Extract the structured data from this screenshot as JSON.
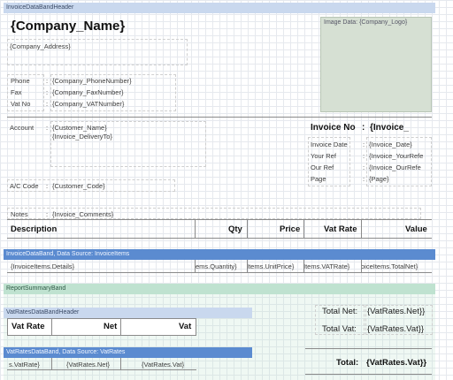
{
  "bands": {
    "invoice_header": "InvoiceDataBandHeader",
    "invoice_band": "InvoiceDataBand, Data Source: InvoiceItems",
    "report_summary": "ReportSummaryBand",
    "vat_header": "VatRatesDataBandHeader",
    "vat_band": "VatRatesDataBand, Data Source: VatRates"
  },
  "company": {
    "name": "{Company_Name}",
    "address": "{Company_Address}",
    "logo": "Image Data: {Company_Logo}"
  },
  "contact": {
    "phone_label": "Phone",
    "fax_label": "Fax",
    "vat_label": "Vat No",
    "phone_value": "{Company_PhoneNumber}",
    "fax_value": "{Company_FaxNumber}",
    "vat_value": "{Company_VATNumber}"
  },
  "account": {
    "label": "Account",
    "customer_name": "{Customer_Name}",
    "delivery_to": "{Invoice_DeliveryTo}",
    "ac_code_label": "A/C Code",
    "customer_code": "{Customer_Code}",
    "notes_label": "Notes",
    "comments": "{Invoice_Comments}"
  },
  "invoice": {
    "no_label": "Invoice No",
    "no_sep": ":",
    "no_value": "{Invoice_",
    "date_label": "Invoice Date",
    "your_ref_label": "Your Ref",
    "our_ref_label": "Our Ref",
    "page_label": "Page",
    "date_value": "{Invoice_Date}",
    "your_ref_value": "{Invoice_YourRefe",
    "our_ref_value": "{Invoice_OurRefe",
    "page_value": "{Page}"
  },
  "table": {
    "headers": [
      "Description",
      "Qty",
      "Price",
      "Vat Rate",
      "Value"
    ],
    "row": [
      "{InvoiceItems.Details}",
      "ems.Quantity}",
      "Items.UnitPrice}",
      "Items.VATRate}",
      "oiceItems.TotalNet}"
    ]
  },
  "vat_table": {
    "headers": [
      "Vat Rate",
      "Net",
      "Vat"
    ],
    "row": [
      "s.VatRate}",
      "{VatRates.Net}",
      "{VatRates.Vat}"
    ]
  },
  "totals": {
    "total_net_label": "Total Net:",
    "total_net_value": "{VatRates.Net}}",
    "total_vat_label": "Total Vat:",
    "total_vat_value": "{VatRates.Vat}}",
    "total_label": "Total:",
    "total_value": "{VatRates.Vat}}"
  }
}
